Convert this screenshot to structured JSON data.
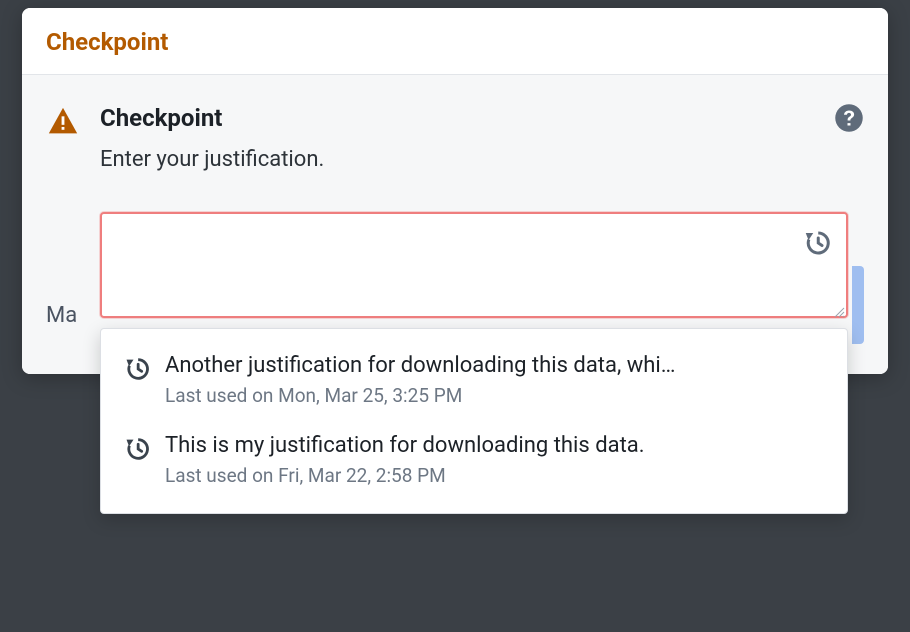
{
  "header": {
    "title": "Checkpoint"
  },
  "body": {
    "title": "Checkpoint",
    "subtitle": "Enter your justification.",
    "textarea_value": "",
    "hidden_label_fragment": "Ma",
    "help_aria": "Help"
  },
  "history_items": [
    {
      "text": "Another justification for downloading this data, whi…",
      "last_used": "Last used on Mon, Mar 25, 3:25 PM"
    },
    {
      "text": "This is my justification for downloading this data.",
      "last_used": "Last used on Fri, Mar 22, 2:58 PM"
    }
  ]
}
